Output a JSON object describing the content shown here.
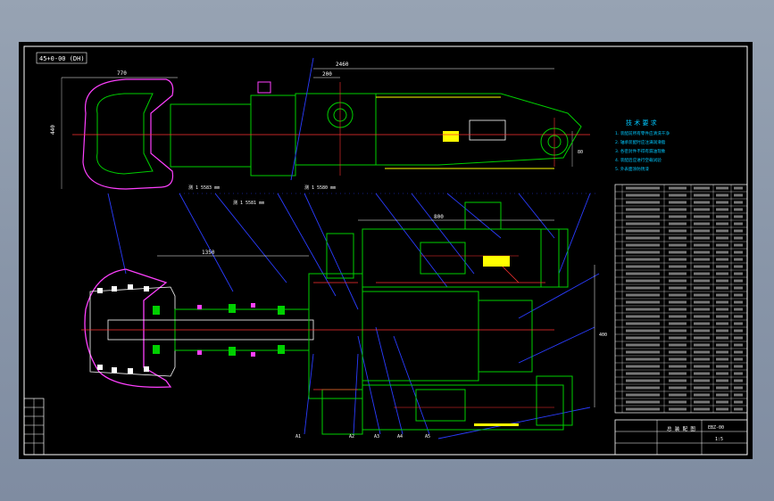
{
  "drawing": {
    "tag_label": "45+0-00 (DH)",
    "dims": {
      "overall_length": "2460",
      "bucket_width": "770",
      "upper_1": "1200",
      "upper_2": "200",
      "height_left": "440",
      "height_right": "80",
      "callout_1": "测 1 5583 mm",
      "callout_2": "测 1 5580 mm",
      "callout_3": "测 1 5581 mm",
      "lower_1": "1350",
      "lower_2": "800",
      "lower_3": "400"
    },
    "notes_title": "技 术 要 求",
    "notes": [
      "1. 装配前所有零件应清洗干净",
      "2. 轴承装配时应注满润滑脂",
      "3. 各密封件不得有漏油现象",
      "4. 装配后应进行空载试验",
      "5. 外表面涂防锈漆"
    ],
    "bottom_labels": [
      "A1",
      "A2",
      "A3",
      "A4",
      "A5"
    ],
    "title_block": {
      "drawing_name": "总 装 配 图",
      "drawing_no": "EBZ-00",
      "scale": "1:5"
    }
  },
  "colors": {
    "outline": "#ffffff",
    "green": "#00d000",
    "yellow": "#ffff00",
    "red": "#ff3030",
    "blue": "#2a3cff",
    "magenta": "#ff40ff",
    "cyan": "#00c8ff",
    "frame": "#ffffff"
  }
}
